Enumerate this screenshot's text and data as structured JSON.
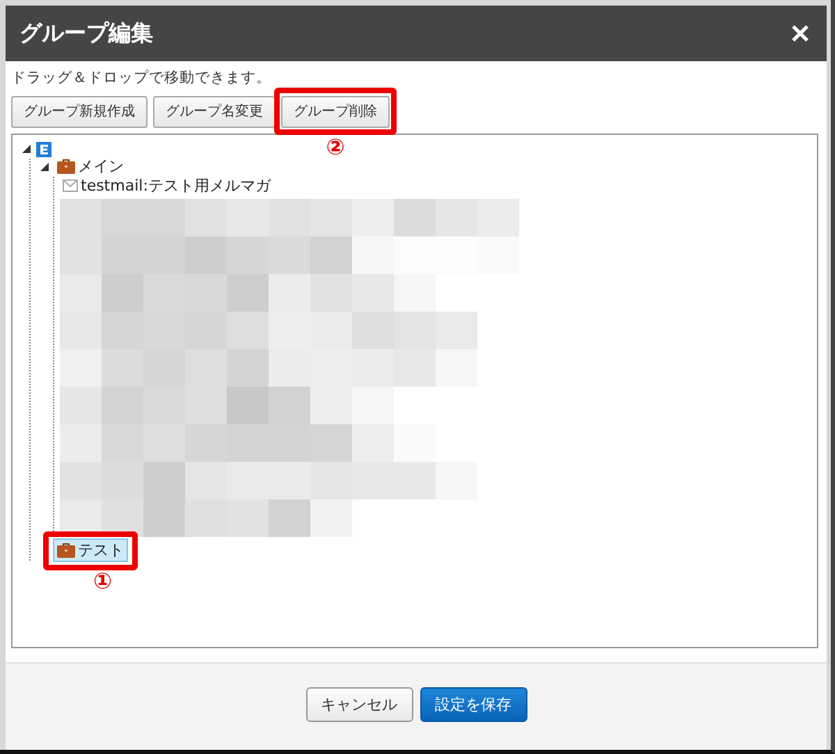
{
  "window": {
    "title": "グループ編集"
  },
  "hint": "ドラッグ＆ドロップで移動できます。",
  "toolbar": [
    {
      "label": "グループ新規作成"
    },
    {
      "label": "グループ名変更"
    },
    {
      "label": "グループ削除",
      "annotation": "②"
    }
  ],
  "tree": {
    "kind": "root",
    "expanded": true,
    "children": [
      {
        "kind": "folder",
        "label": "メイン",
        "expanded": true,
        "selected": false,
        "children": [
          {
            "kind": "mail",
            "label": "testmail:テスト用メルマガ",
            "selected": false
          }
        ]
      },
      {
        "kind": "folder",
        "label": "テスト",
        "selected": true,
        "annotation": "①"
      }
    ]
  },
  "footer": [
    {
      "label": "キャンセル",
      "kind": "secondary"
    },
    {
      "label": "設定を保存",
      "kind": "primary"
    }
  ]
}
